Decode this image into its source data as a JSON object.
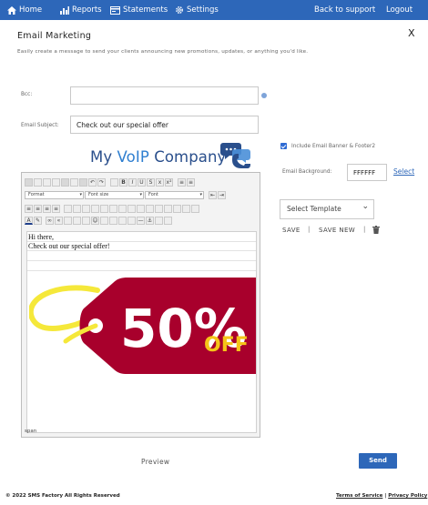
{
  "nav": {
    "home": "Home",
    "reports": "Reports",
    "statements": "Statements",
    "settings": "Settings",
    "back_to_support": "Back to support",
    "logout": "Logout"
  },
  "page": {
    "title": "Email Marketing",
    "close_label": "X",
    "subtitle": "Easily create a message to send your clients announcing new promotions, updates, or anything you'd like."
  },
  "form": {
    "bcc_label": "Bcc:",
    "bcc_value": "",
    "subject_label": "Email Subject:",
    "subject_value": "Check out our special offer"
  },
  "brand": {
    "name_part1": "My ",
    "name_part2": "VoIP",
    "name_part3": " Company"
  },
  "editor": {
    "format_select": "Format",
    "font_size_select": "Font size",
    "font_select": "Font",
    "line1": "Hi there,",
    "line2": "Check out our special offer!",
    "promo_number": "50%",
    "promo_off": "OFF",
    "status": "span",
    "promo_tag_color": "#a8002c",
    "promo_string_color": "#f5e83a"
  },
  "options": {
    "include_banner_label": "Include Email Banner & Footer2",
    "include_banner_checked": true,
    "bg_label": "Email Background:",
    "bg_value": "FFFFFF",
    "select_link": "Select",
    "template_select": "Select Template",
    "save": "SAVE",
    "save_new": "SAVE NEW",
    "separator": "|"
  },
  "actions": {
    "preview": "Preview",
    "send": "Send"
  },
  "footer": {
    "copyright": "© 2022 SMS Factory All Rights Reserved",
    "terms": "Terms of Service",
    "divider": " | ",
    "privacy": "Privacy Policy"
  },
  "colors": {
    "nav_bg": "#2d67b9",
    "accent": "#2d67b9"
  }
}
